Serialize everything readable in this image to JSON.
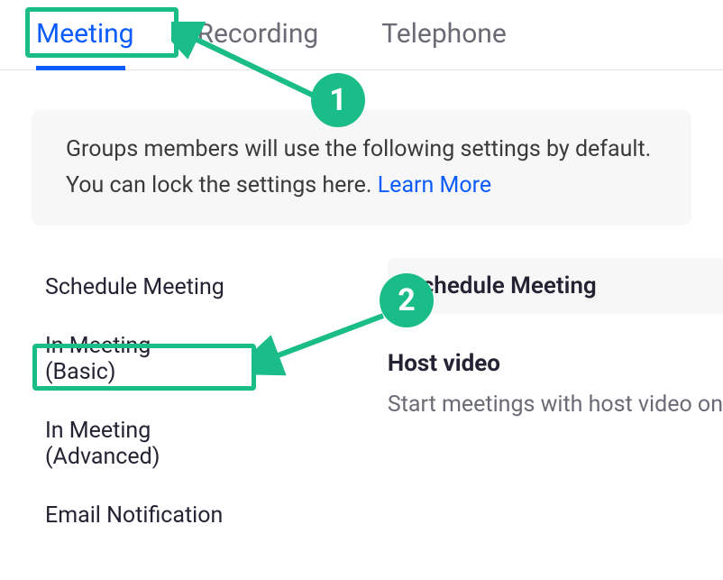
{
  "tabs": {
    "meeting": "Meeting",
    "recording": "Recording",
    "telephone": "Telephone"
  },
  "banner": {
    "text_prefix": "Groups members will use the following settings by default. You can lock the settings here. ",
    "link": "Learn More"
  },
  "sidebar": {
    "items": [
      "Schedule Meeting",
      "In Meeting (Basic)",
      "In Meeting (Advanced)",
      "Email Notification"
    ]
  },
  "main": {
    "section_header": "Schedule Meeting",
    "setting1_title": "Host video",
    "setting1_desc": "Start meetings with host video on"
  },
  "annotations": {
    "badge1": "1",
    "badge2": "2"
  },
  "colors": {
    "accent": "#0b5cff",
    "annotation": "#1abc87"
  }
}
